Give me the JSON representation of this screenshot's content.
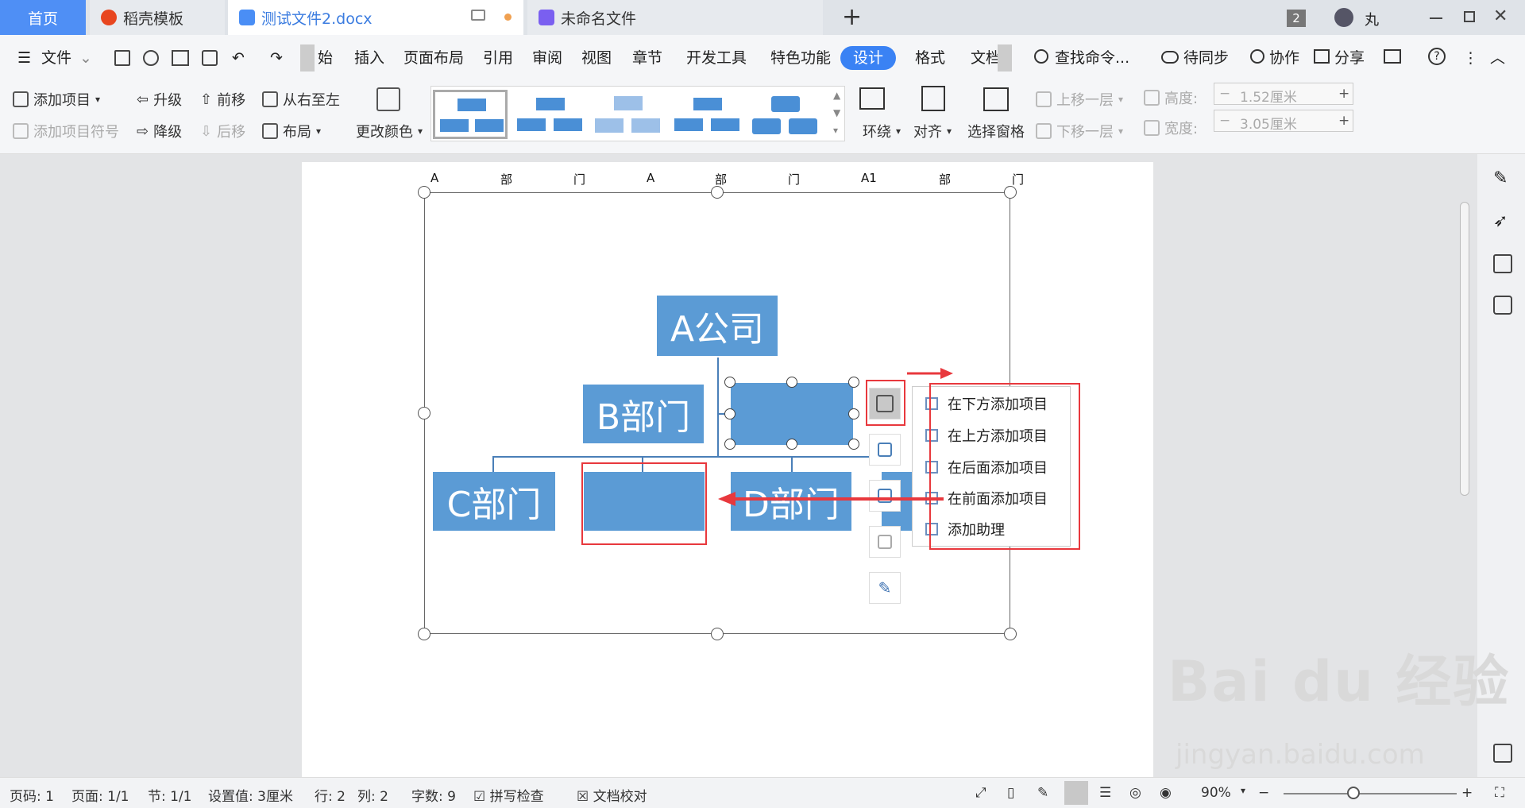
{
  "tabs": {
    "home": "首页",
    "t1": "稻壳模板",
    "t2": "测试文件2.docx",
    "t3": "未命名文件",
    "add": "+",
    "badge": "2",
    "user": "丸"
  },
  "menubar": {
    "file": "文件",
    "start": "始",
    "insert": "插入",
    "layout": "页面布局",
    "ref": "引用",
    "review": "审阅",
    "view": "视图",
    "chapter": "章节",
    "dev": "开发工具",
    "special": "特色功能",
    "design": "设计",
    "format": "格式",
    "doc": "文档",
    "search": "查找命令...",
    "sync": "待同步",
    "collab": "协作",
    "share": "分享"
  },
  "ribbon": {
    "add_item": "添加项目",
    "add_bullet": "添加项目符号",
    "promote": "升级",
    "demote": "降级",
    "move_up": "前移",
    "move_down": "后移",
    "rtl": "从右至左",
    "layout": "布局",
    "change_color": "更改颜色",
    "wrap": "环绕",
    "align": "对齐",
    "select_pane": "选择窗格",
    "bring_forward": "上移一层",
    "send_backward": "下移一层",
    "height_label": "高度:",
    "height_value": "1.52厘米",
    "width_label": "宽度:",
    "width_value": "3.05厘米"
  },
  "doc": {
    "ruler_text": [
      "A",
      "部",
      "门",
      "A",
      "部",
      "门",
      "A1",
      "部",
      "门"
    ],
    "box_a": "A公司",
    "box_b": "B部门",
    "box_c": "C部门",
    "box_d": "D部门"
  },
  "context_menu": {
    "items": [
      "在下方添加项目",
      "在上方添加项目",
      "在后面添加项目",
      "在前面添加项目",
      "添加助理"
    ]
  },
  "statusbar": {
    "page_no": "页码: 1",
    "pages": "页面: 1/1",
    "section": "节: 1/1",
    "setting": "设置值: 3厘米",
    "row": "行: 2",
    "col": "列: 2",
    "words": "字数: 9",
    "spell": "拼写检查",
    "proof": "文档校对",
    "zoom": "90%"
  },
  "watermark": {
    "brand": "Bai du 经验",
    "url": "jingyan.baidu.com"
  },
  "colors": {
    "accent": "#3a82f4",
    "box": "#5b9bd5",
    "highlight": "#e8383d"
  }
}
